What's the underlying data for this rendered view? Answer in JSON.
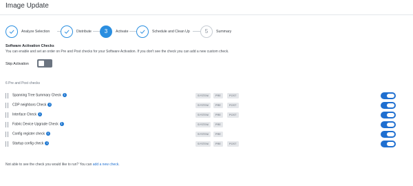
{
  "page": {
    "title": "Image Update"
  },
  "stepper": {
    "steps": [
      {
        "number": "",
        "label": "Analyze Selection",
        "state": "done"
      },
      {
        "number": "",
        "label": "Distribute",
        "state": "done"
      },
      {
        "number": "3",
        "label": "Activate",
        "state": "active"
      },
      {
        "number": "",
        "label": "Schedule and Clean Up",
        "state": "done"
      },
      {
        "number": "5",
        "label": "Summary",
        "state": "todo"
      }
    ]
  },
  "section": {
    "heading": "Software Activation Checks",
    "description": "You can enable and set an order on Pre and Post checks for your Software Activation. If you don't see the check you can add a new custom check."
  },
  "skip_activation": {
    "label": "Skip Activation",
    "enabled": false
  },
  "checks_count_label": "6 Pre and Post checks",
  "checks": [
    {
      "name": "Spanning Tree Summary Check",
      "tags": [
        "SYSTEM",
        "PRE",
        "POST"
      ],
      "enabled": true
    },
    {
      "name": "CDP neighbors Check",
      "tags": [
        "SYSTEM",
        "PRE",
        "POST"
      ],
      "enabled": true
    },
    {
      "name": "Interface Check",
      "tags": [
        "SYSTEM",
        "PRE",
        "POST"
      ],
      "enabled": true
    },
    {
      "name": "Fabric Device Upgrade Check",
      "tags": [
        "SYSTEM",
        "PRE"
      ],
      "enabled": true
    },
    {
      "name": "Config register check",
      "tags": [
        "SYSTEM",
        "PRE"
      ],
      "enabled": true
    },
    {
      "name": "Startup config check",
      "tags": [
        "SYSTEM",
        "PRE",
        "POST"
      ],
      "enabled": true
    }
  ],
  "footer": {
    "text": "Not able to see the check you would like to run? You can ",
    "link": "add a new check",
    "suffix": "."
  },
  "colors": {
    "accent": "#2a8ee0",
    "toggle_on": "#1f6fd0",
    "toggle_off": "#6b7480"
  }
}
